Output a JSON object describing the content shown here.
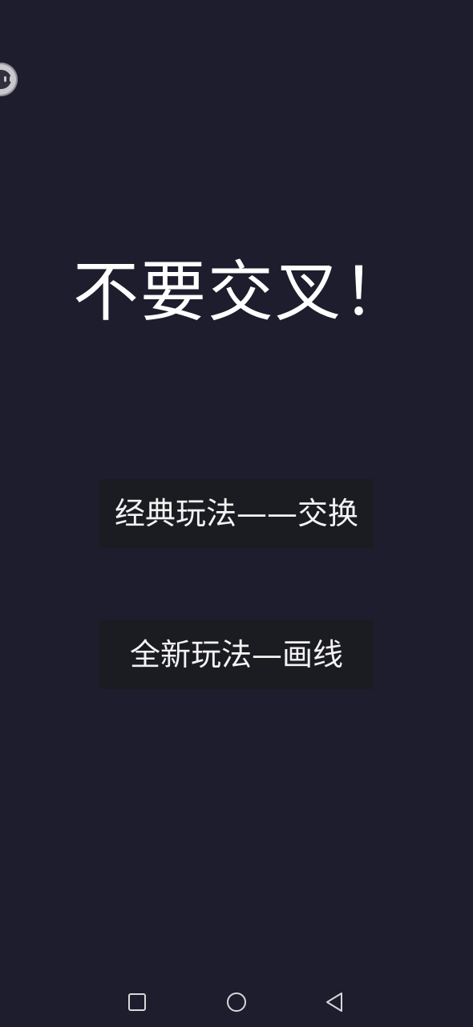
{
  "floating_assistant": {
    "icon": "robot-face-icon"
  },
  "title": "不要交叉！",
  "modes": {
    "classic_label": "经典玩法——交换",
    "draw_label": "全新玩法—画线"
  },
  "nav_bar": {
    "recents_icon": "square-icon",
    "home_icon": "circle-icon",
    "back_icon": "triangle-back-icon"
  },
  "colors": {
    "background": "#1e1d2d",
    "button_bg": "#1b1b22",
    "text": "#ffffff"
  }
}
